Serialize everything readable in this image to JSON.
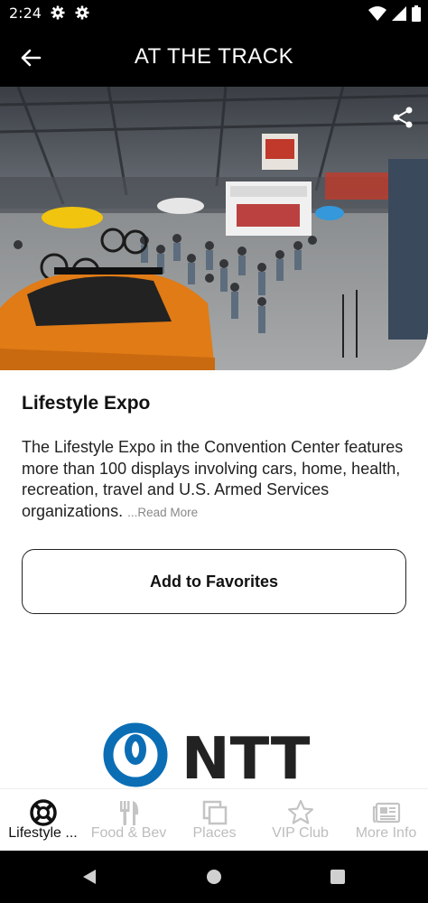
{
  "status": {
    "time": "2:24",
    "left_icons": [
      "gear-icon",
      "gear-icon"
    ],
    "right_icons": [
      "wifi-icon",
      "signal-icon",
      "battery-icon"
    ]
  },
  "header": {
    "title": "AT THE TRACK",
    "back_icon": "arrow-left-icon",
    "share_icon": "share-icon"
  },
  "event": {
    "title": "Lifestyle Expo",
    "description": "The Lifestyle Expo in the Convention Center features more than 100 displays involving cars, home, health, recreation, travel and U.S. Armed Services organizations.",
    "read_more": "...Read More",
    "favorite_label": "Add to Favorites"
  },
  "sponsor": {
    "name": "NTT",
    "color": "#0b6eb5"
  },
  "bottom_nav": {
    "items": [
      {
        "label": "Lifestyle ...",
        "icon": "lifebuoy-icon",
        "active": true
      },
      {
        "label": "Food & Bev",
        "icon": "utensils-icon",
        "active": false
      },
      {
        "label": "Places",
        "icon": "places-icon",
        "active": false
      },
      {
        "label": "VIP Club",
        "icon": "star-icon",
        "active": false
      },
      {
        "label": "More Info",
        "icon": "newspaper-icon",
        "active": false
      }
    ]
  },
  "colors": {
    "bar_bg": "#000000",
    "active": "#111111",
    "inactive": "#bdbdbd"
  }
}
